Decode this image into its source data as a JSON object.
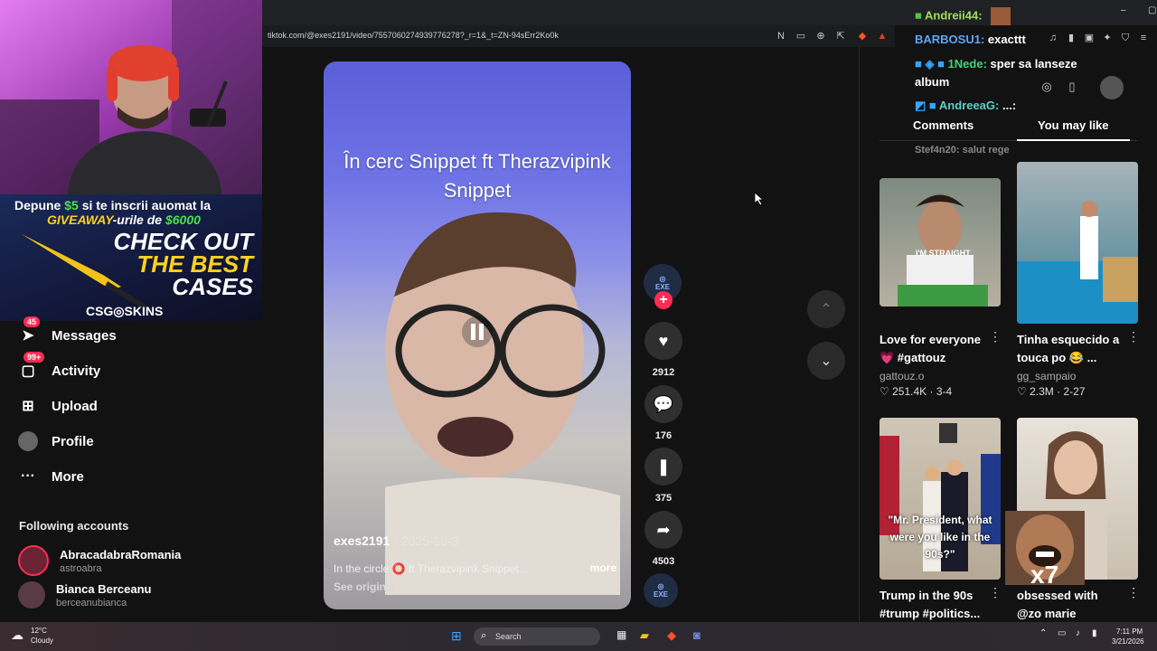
{
  "browser": {
    "url": "tiktok.com/@exes2191/video/7557060274939776278?_r=1&_t=ZN-94sErr2Ko0k",
    "window_controls": {
      "minimize": "–",
      "maximize": "▢",
      "close": "✕"
    }
  },
  "overlay_ad": {
    "line1": "Depune $5 si te inscrii auomat la",
    "line1_amount": "$5",
    "line2": "GIVEAWAY-urile de $6000",
    "line3": "CHECK OUT",
    "line4": "THE BEST",
    "line5": "CASES",
    "brand": "CSG◎SKINS"
  },
  "nav": {
    "items": [
      {
        "label": "Messages",
        "badge": "45",
        "icon": "paper-plane-icon"
      },
      {
        "label": "Activity",
        "badge": "99+",
        "icon": "inbox-icon"
      },
      {
        "label": "Upload",
        "badge": "",
        "icon": "plus-square-icon"
      },
      {
        "label": "Profile",
        "badge": "",
        "icon": "avatar"
      },
      {
        "label": "More",
        "badge": "",
        "icon": "more-dots-icon"
      }
    ],
    "following_title": "Following accounts",
    "following": [
      {
        "name": "AbracadabraRomania",
        "handle": "astroabra"
      },
      {
        "name": "Bianca Berceanu",
        "handle": "berceanubianca"
      }
    ]
  },
  "video": {
    "title_line1": "În cerc Snippet ft Therazvipink",
    "title_line2": "Snippet",
    "author": "exes2191",
    "date": "· 2025-10-3",
    "caption": "In the circle ⭕ ft Therazvipink Snippet...",
    "more": "more",
    "see_original": "See original"
  },
  "actions": {
    "avatar_label": "EXE",
    "likes": "2912",
    "comments": "176",
    "saves": "375",
    "shares": "4503"
  },
  "chat": [
    {
      "user": "Andreii44:",
      "msg": "",
      "color": "#9de05a"
    },
    {
      "user": "BARBOSU1:",
      "msg": "exacttt",
      "color": "#5aa8ff"
    },
    {
      "user": "1Nede:",
      "msg": "sper sa lanseze",
      "color": "#44d17a"
    },
    {
      "user": "",
      "msg": "album",
      "color": "#ffffff"
    },
    {
      "user": "AndreeaG:",
      "msg": "...:",
      "color": "#5fd0c8"
    },
    {
      "user": "Stef4n20:",
      "msg": "salut rege",
      "color": "#8a8a8a"
    }
  ],
  "right_panel": {
    "tab_comments": "Comments",
    "tab_you_may_like": "You may like",
    "videos": [
      {
        "title": "Love for everyone 💗 #gattouz",
        "user": "gattouz.o",
        "likes": "251.4K",
        "date": "3-4",
        "overlay": "I'M STRAIGHT"
      },
      {
        "title": "Tinha esquecido a touca po 😂 ...",
        "user": "gg_sampaio",
        "likes": "2.3M",
        "date": "2-27",
        "overlay": ""
      },
      {
        "title": "Trump in the 90s #trump #politics...",
        "user": "",
        "likes": "",
        "date": "",
        "overlay": "\"Mr. President, what were you like in the 90s?\""
      },
      {
        "title": "obsessed with @zo marie",
        "user": "",
        "likes": "",
        "date": "",
        "overlay": ""
      }
    ]
  },
  "taskbar": {
    "temp": "12°C",
    "weather": "Cloudy",
    "search": "Search",
    "time": "7:11 PM",
    "date": "3/21/2026"
  },
  "colors": {
    "accent": "#fe2c55",
    "bg": "#121212"
  }
}
